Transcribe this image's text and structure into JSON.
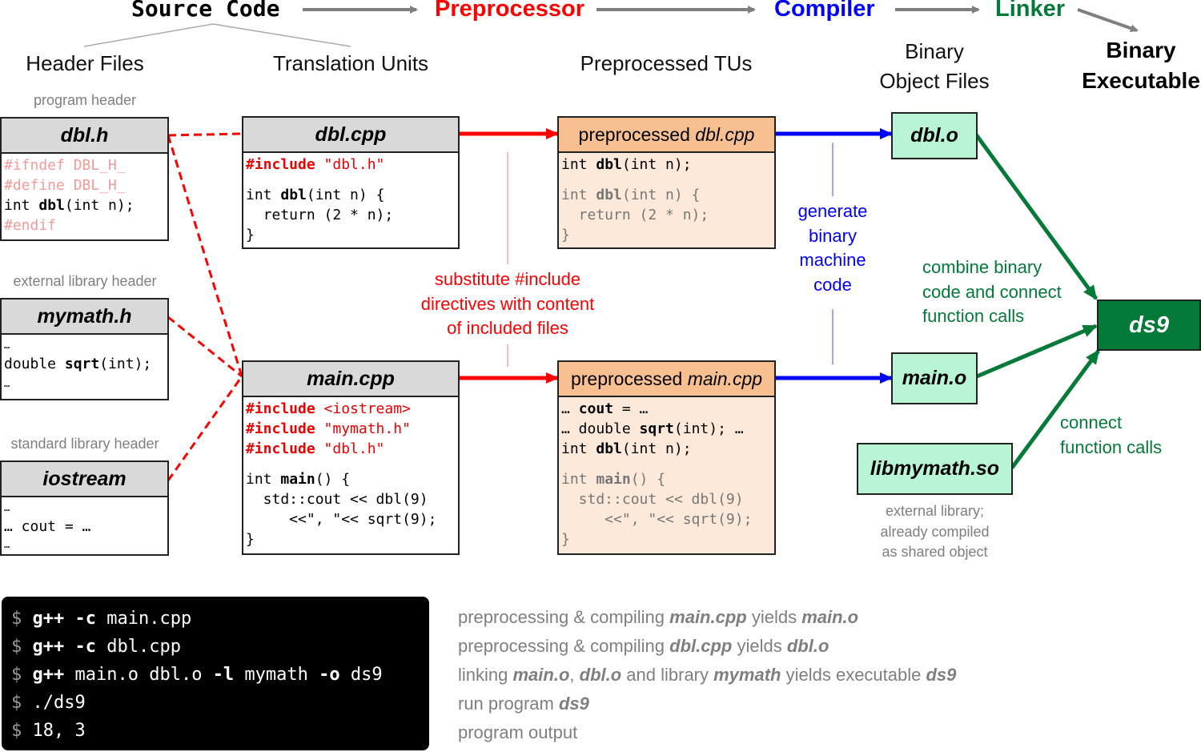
{
  "stages": {
    "source_code": "Source Code",
    "preprocessor": "Preprocessor",
    "compiler": "Compiler",
    "linker": "Linker",
    "binary_executable_line1": "Binary",
    "binary_executable_line2": "Executable"
  },
  "colors": {
    "preprocessor": "#ff0000",
    "compiler": "#0000ff",
    "linker": "#047a38",
    "preprocessed_header": "#f8c090",
    "preprocessed_body": "#fde9d9",
    "object_file": "#b7f5d4",
    "executable": "#047a38"
  },
  "columns": {
    "header_files": "Header Files",
    "translation_units": "Translation Units",
    "preprocessed_tus": "Preprocessed TUs",
    "object_files_line1": "Binary",
    "object_files_line2": "Object Files"
  },
  "headers": {
    "dbl_h": {
      "caption": "program header",
      "title": "dbl.h",
      "lines": [
        "#ifndef DBL_H_",
        "#define DBL_H_",
        "int ",
        "dbl",
        "(int n);",
        "#endif"
      ]
    },
    "mymath_h": {
      "caption": "external library header",
      "title": "mymath.h",
      "lines": [
        "…",
        "double ",
        "sqrt",
        "(int);",
        "…"
      ]
    },
    "iostream": {
      "caption": "standard library header",
      "title": "iostream",
      "lines": [
        "…",
        "… cout = …",
        "…"
      ]
    }
  },
  "translation_units": {
    "dbl_cpp": {
      "title": "dbl.cpp",
      "include_kw": "#include",
      "include_arg": " \"dbl.h\"",
      "def_a": "int ",
      "def_b": "dbl",
      "def_c": "(int n) {",
      "ret": "  return (2 * n);",
      "close": "}"
    },
    "main_cpp": {
      "title": "main.cpp",
      "includes": [
        {
          "kw": "#include",
          "arg": " <iostream>"
        },
        {
          "kw": "#include",
          "arg": " \"mymath.h\""
        },
        {
          "kw": "#include",
          "arg": " \"dbl.h\""
        }
      ],
      "main_a": "int ",
      "main_b": "main",
      "main_c": "() {",
      "l1": "  std::cout << dbl(9)",
      "l2": "     <<\", \"<< sqrt(9);",
      "close": "}"
    }
  },
  "preprocessed": {
    "dbl": {
      "title_prefix": "preprocessed ",
      "title_file": "dbl.cpp",
      "decl_a": "int ",
      "decl_b": "dbl",
      "decl_c": "(int n);",
      "def_a": "int ",
      "def_b": "dbl",
      "def_c": "(int n) {",
      "ret": "  return (2 * n);",
      "close": "}"
    },
    "main": {
      "title_prefix": "preprocessed ",
      "title_file": "main.cpp",
      "l1a": "… ",
      "l1b": "cout",
      "l1c": " = …",
      "l2a": "… double ",
      "l2b": "sqrt",
      "l2c": "(int); …",
      "l3a": "int ",
      "l3b": "dbl",
      "l3c": "(int n);",
      "main_a": "int ",
      "main_b": "main",
      "main_c": "() {",
      "l4": "  std::cout << dbl(9)",
      "l5": "     <<\", \"<< sqrt(9);",
      "close": "}"
    }
  },
  "annotations": {
    "preprocessor_note": [
      "substitute #include",
      "directives with content",
      "of included files"
    ],
    "compiler_note": [
      "generate",
      "binary",
      "machine",
      "code"
    ],
    "linker_note": [
      "combine binary",
      "code and connect",
      "function calls"
    ],
    "library_note": [
      "connect",
      "function calls"
    ],
    "library_caption": [
      "external library;",
      "already compiled",
      "as shared object"
    ]
  },
  "objects": {
    "dbl_o": "dbl.o",
    "main_o": "main.o",
    "libmymath": "libmymath.so",
    "executable": "ds9"
  },
  "terminal": {
    "prompt": "$",
    "lines": [
      {
        "cmd": "g++",
        "flag": " -c",
        "rest": " main.cpp"
      },
      {
        "cmd": "g++",
        "flag": " -c",
        "rest": " dbl.cpp"
      },
      {
        "cmd": "g++",
        "rest1": " main.o dbl.o ",
        "flag1": "-l",
        "rest2": " mymath ",
        "flag2": "-o",
        "rest3": " ds9"
      },
      {
        "text": " ./ds9"
      },
      {
        "text": " 18, 3"
      }
    ]
  },
  "explanations": [
    {
      "a": "preprocessing & compiling ",
      "b": "main.cpp",
      "c": " yields ",
      "d": "main.o"
    },
    {
      "a": "preprocessing & compiling ",
      "b": "dbl.cpp",
      "c": " yields ",
      "d": "dbl.o"
    },
    {
      "a": "linking ",
      "b": "main.o",
      "c": ", ",
      "d": "dbl.o",
      "e": " and library ",
      "f": "mymath",
      "g": " yields executable ",
      "h": "ds9"
    },
    {
      "a": "run program ",
      "b": "ds9"
    },
    {
      "a": "program output"
    }
  ]
}
